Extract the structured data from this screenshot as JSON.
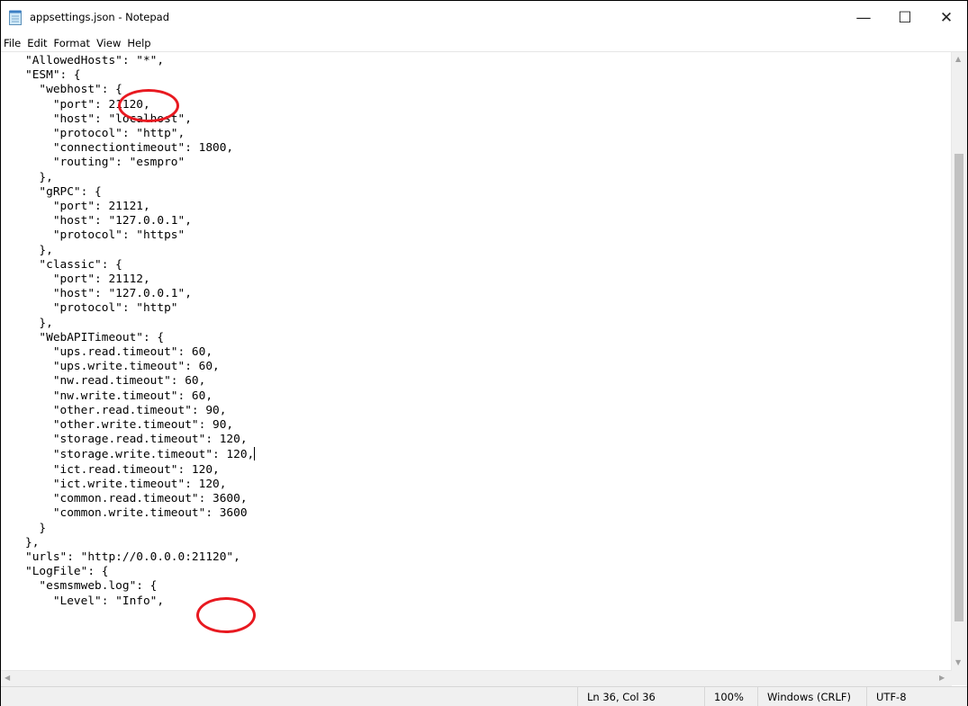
{
  "window": {
    "title": "appsettings.json - Notepad",
    "icon": "notepad-icon",
    "minimize_glyph": "—",
    "maximize_glyph": "☐",
    "close_glyph": "✕"
  },
  "menu": [
    "File",
    "Edit",
    "Format",
    "View",
    "Help"
  ],
  "editor": {
    "content_before_caret": "\"AllowedHosts\": \"*\",\n\"ESM\": {\n  \"webhost\": {\n    \"port\": 21120,\n    \"host\": \"localhost\",\n    \"protocol\": \"http\",\n    \"connectiontimeout\": 1800,\n    \"routing\": \"esmpro\"\n  },\n  \"gRPC\": {\n    \"port\": 21121,\n    \"host\": \"127.0.0.1\",\n    \"protocol\": \"https\"\n  },\n  \"classic\": {\n    \"port\": 21112,\n    \"host\": \"127.0.0.1\",\n    \"protocol\": \"http\"\n  },\n  \"WebAPITimeout\": {\n    \"ups.read.timeout\": 60,\n    \"ups.write.timeout\": 60,\n    \"nw.read.timeout\": 60,\n    \"nw.write.timeout\": 60,\n    \"other.read.timeout\": 90,\n    \"other.write.timeout\": 90,\n    \"storage.read.timeout\": 120,\n    \"storage.write.timeout\": 120,",
    "content_after_caret": "\n    \"ict.read.timeout\": 120,\n    \"ict.write.timeout\": 120,\n    \"common.read.timeout\": 3600,\n    \"common.write.timeout\": 3600\n  }\n},\n\"urls\": \"http://0.0.0.0:21120\",\n\"LogFile\": {\n  \"esmsmweb.log\": {\n    \"Level\": \"Info\","
  },
  "annotations": {
    "color": "#e81920",
    "labels": [
      "webhost-port-highlight",
      "urls-port-highlight"
    ]
  },
  "status": {
    "position": "Ln 36, Col 36",
    "zoom": "100%",
    "line_ending": "Windows (CRLF)",
    "encoding": "UTF-8"
  }
}
